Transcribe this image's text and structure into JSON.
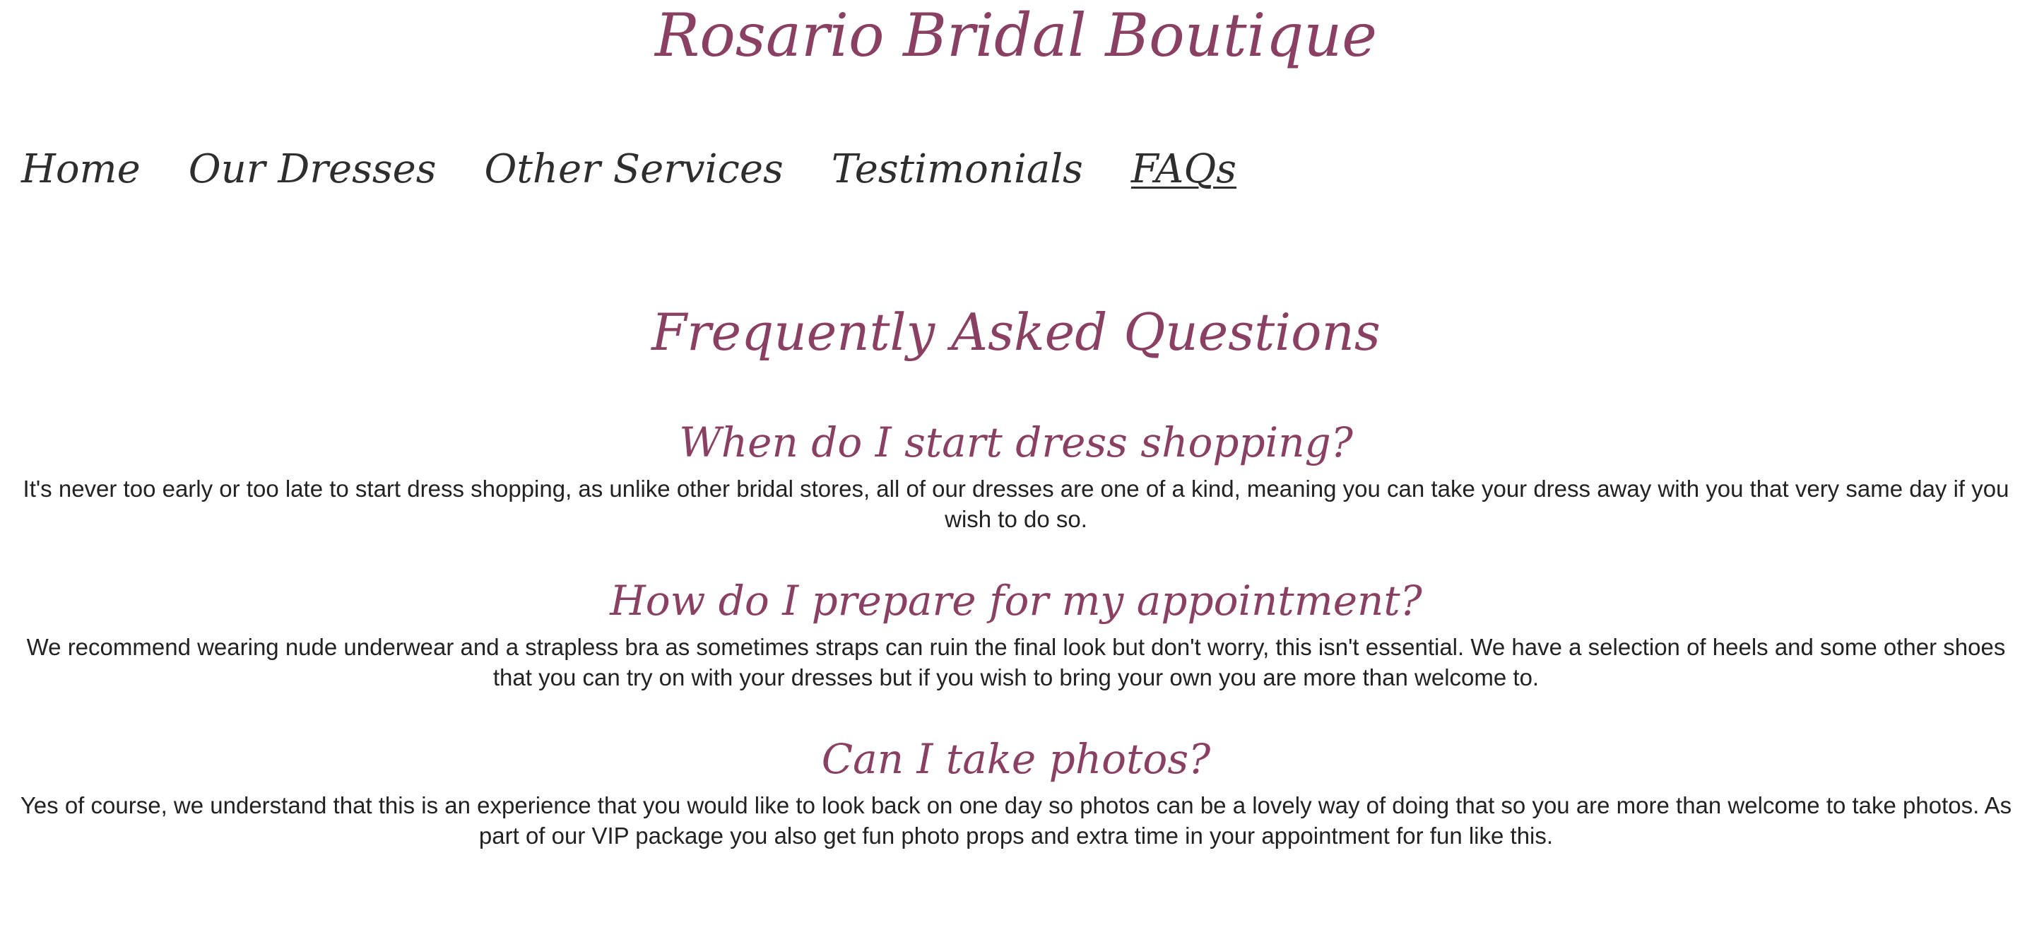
{
  "site": {
    "title": "Rosario Bridal Boutique"
  },
  "nav": {
    "items": [
      {
        "label": "Home"
      },
      {
        "label": "Our Dresses"
      },
      {
        "label": "Other Services"
      },
      {
        "label": "Testimonials"
      },
      {
        "label": "FAQs"
      }
    ],
    "active": "FAQs"
  },
  "main": {
    "heading": "Frequently Asked Questions",
    "faqs": [
      {
        "question": "When do I start dress shopping?",
        "answer": "It's never too early or too late to start dress shopping, as unlike other bridal stores, all of our dresses are one of a kind, meaning you can take your dress away with you that very same day if you wish to do so."
      },
      {
        "question": "How do I prepare for my appointment?",
        "answer": "We recommend wearing nude underwear and a strapless bra as sometimes straps can ruin the final look but don't worry, this isn't essential. We have a selection of heels and some other shoes that you can try on with your dresses but if you wish to bring your own you are more than welcome to."
      },
      {
        "question": "Can I take photos?",
        "answer": "Yes of course, we understand that this is an experience that you would like to look back on one day so photos can be a lovely way of doing that so you are more than welcome to take photos. As part of our VIP package you also get fun photo props and extra time in your appointment for fun like this."
      }
    ]
  },
  "colors": {
    "accent": "#8a4062",
    "nav_text": "#2e2e2e",
    "body_text": "#222222",
    "background": "#ffffff"
  }
}
